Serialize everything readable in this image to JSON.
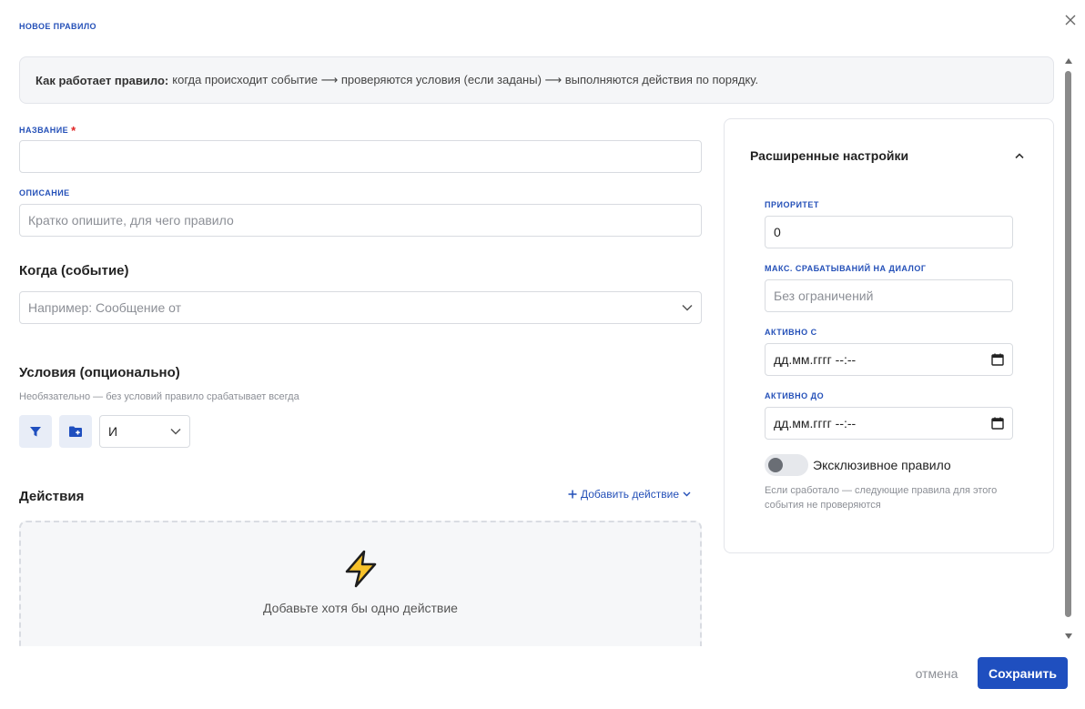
{
  "modal": {
    "title": "НОВОЕ ПРАВИЛО",
    "close_icon": "close-icon"
  },
  "info": {
    "bold": "Как работает правило:",
    "text": "когда происходит событие ⟶ проверяются условия (если заданы) ⟶ выполняются действия по порядку."
  },
  "name_field": {
    "label": "НАЗВАНИЕ",
    "required_mark": "*",
    "value": ""
  },
  "description_field": {
    "label": "ОПИСАНИЕ",
    "placeholder": "Кратко опишите, для чего правило"
  },
  "trigger": {
    "title": "Когда (событие)",
    "placeholder": "Например: Сообщение от"
  },
  "conditions": {
    "title": "Условия (опционально)",
    "hint": "Необязательно — без условий правило срабатывает всегда",
    "add_condition_icon": "filter-icon",
    "add_group_icon": "folder-plus-icon",
    "operator": "И"
  },
  "actions": {
    "title": "Действия",
    "add_label": "Добавить действие",
    "empty_text": "Добавьте хотя бы одно действие",
    "empty_icon": "lightning-icon"
  },
  "advanced": {
    "title": "Расширенные настройки",
    "priority": {
      "label": "ПРИОРИТЕТ",
      "value": "0"
    },
    "max_triggers": {
      "label": "МАКС. СРАБАТЫВАНИЙ НА ДИАЛОГ",
      "placeholder": "Без ограничений"
    },
    "active_from": {
      "label": "АКТИВНО С",
      "value": "дд.мм.гггг --:--"
    },
    "active_to": {
      "label": "АКТИВНО ДО",
      "value": "дд.мм.гггг --:--"
    },
    "exclusive": {
      "label": "Эксклюзивное правило",
      "enabled": false,
      "hint": "Если сработало — следующие правила для этого события не проверяются"
    }
  },
  "footer": {
    "cancel": "отмена",
    "save": "Сохранить"
  },
  "colors": {
    "accent": "#1f4fbf",
    "label": "#2450b8",
    "required": "#e02424"
  }
}
